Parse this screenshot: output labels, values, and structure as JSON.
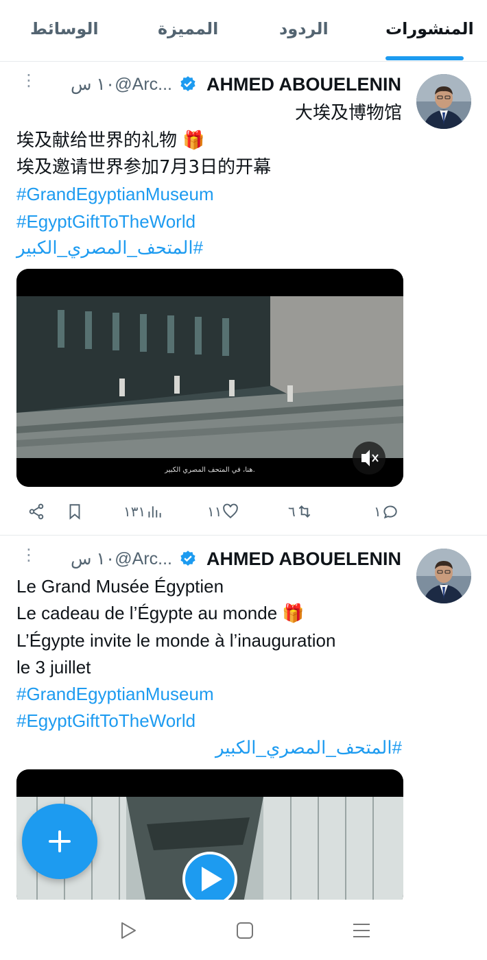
{
  "tabs": [
    {
      "label": "المنشورات",
      "active": true
    },
    {
      "label": "الردود",
      "active": false
    },
    {
      "label": "المميزة",
      "active": false
    },
    {
      "label": "الوسائط",
      "active": false
    }
  ],
  "accent_color": "#1d9bf0",
  "tweets": [
    {
      "author_name": "AHMED ABOUELENIN",
      "handle": "@Arc...",
      "time": "١٠ س",
      "lines": [
        {
          "text": "大埃及博物馆",
          "type": "text"
        },
        {
          "text": "埃及献给世界的礼物 🎁",
          "type": "text"
        },
        {
          "text": "埃及邀请世界参加7月3日的开幕",
          "type": "text"
        },
        {
          "text": "#GrandEgyptianMuseum",
          "type": "hashtag"
        },
        {
          "text": "#EgyptGiftToTheWorld",
          "type": "hashtag"
        },
        {
          "text": "#المتحف_المصري_الكبير",
          "type": "hashtag"
        }
      ],
      "video_caption": "هنا، في المتحف المصري الكبير.",
      "stats": {
        "replies": "١",
        "retweets": "٦",
        "likes": "١١",
        "views": "١٣١"
      }
    },
    {
      "author_name": "AHMED ABOUELENIN",
      "handle": "@Arc...",
      "time": "١٠ س",
      "lines": [
        {
          "text": "Le Grand Musée Égyptien",
          "type": "text"
        },
        {
          "text": "Le cadeau de l’Égypte au monde 🎁",
          "type": "text"
        },
        {
          "text": "L’Égypte invite le monde à l’inauguration",
          "type": "text"
        },
        {
          "text": "le 3 juillet",
          "type": "text"
        },
        {
          "text": "#GrandEgyptianMuseum",
          "type": "hashtag"
        },
        {
          "text": "#EgyptGiftToTheWorld",
          "type": "hashtag"
        },
        {
          "text": "#المتحف_المصري_الكبير",
          "type": "hashtag"
        }
      ]
    }
  ],
  "icons": {
    "fab": "plus-icon",
    "nav": [
      "back-triangle-icon",
      "home-square-icon",
      "recents-lines-icon"
    ]
  }
}
